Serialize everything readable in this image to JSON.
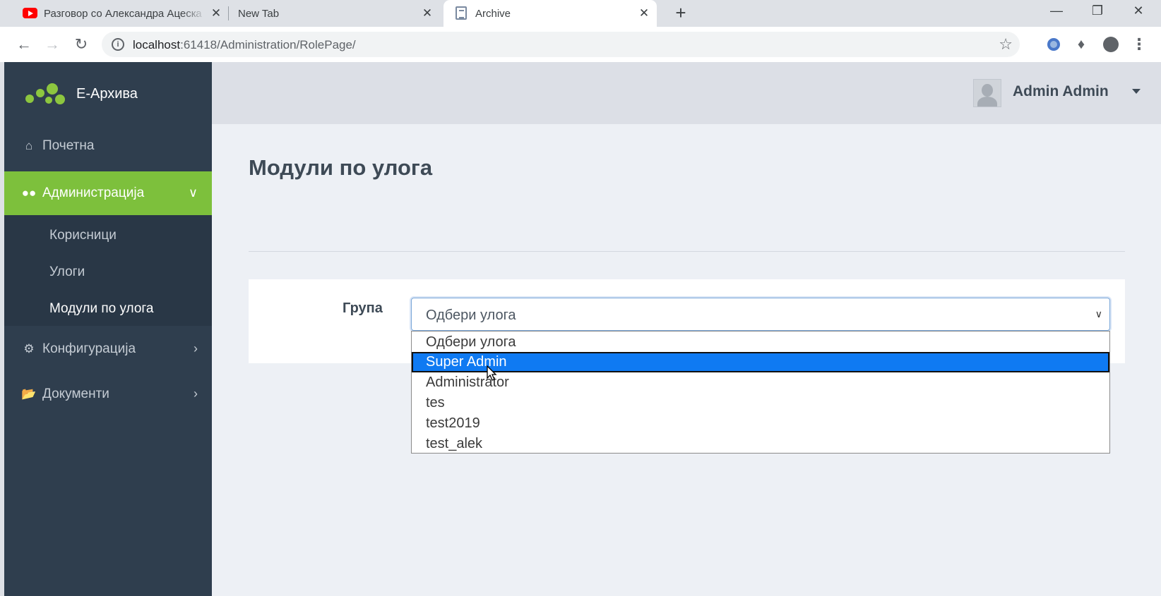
{
  "browser": {
    "tabs": [
      {
        "title": "Разговор со Александра Ацескa",
        "icon": "youtube-icon",
        "active": false
      },
      {
        "title": "New Tab",
        "icon": "",
        "active": false
      },
      {
        "title": "Archive",
        "icon": "document-icon",
        "active": true
      }
    ],
    "close_glyph": "✕",
    "new_tab_glyph": "+",
    "url_host": "localhost",
    "url_path": ":61418/Administration/RolePage/"
  },
  "sidebar": {
    "brand": "Е-Архива",
    "brand_color": "#8dc63f",
    "items": [
      {
        "label": "Почетна",
        "icon": "home-icon"
      },
      {
        "label": "Администрација",
        "icon": "users-icon",
        "expanded": true
      },
      {
        "label": "Конфигурација",
        "icon": "cogs-icon"
      },
      {
        "label": "Документи",
        "icon": "folder-open-icon"
      }
    ],
    "subitems": [
      {
        "label": "Корисници"
      },
      {
        "label": "Улоги"
      },
      {
        "label": "Модули по улога",
        "active": true
      }
    ],
    "active_color": "#7dc03c"
  },
  "header": {
    "user_name": "Admin Admin"
  },
  "main": {
    "title": "Модули по улога",
    "group_label": "Група",
    "select": {
      "value": "Одбери улога",
      "options": [
        "Одбери улога",
        "Super Admin",
        "Administrator",
        "tes",
        "test2019",
        "test_alek"
      ],
      "highlighted": "Super Admin"
    }
  }
}
